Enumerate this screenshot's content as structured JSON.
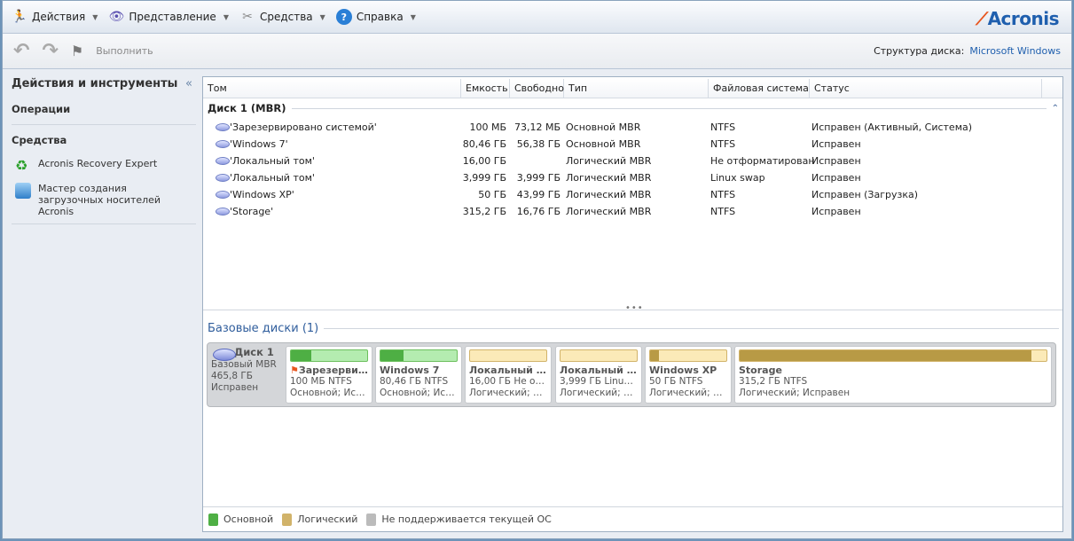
{
  "menu": [
    {
      "label": "Действия",
      "icon": "run-icon"
    },
    {
      "label": "Представление",
      "icon": "eye-icon"
    },
    {
      "label": "Средства",
      "icon": "tools-icon"
    },
    {
      "label": "Справка",
      "icon": "help-icon"
    }
  ],
  "logo": "Acronis",
  "toolbar": {
    "commit": "Выполнить"
  },
  "structure": {
    "label": "Структура диска:",
    "value": "Microsoft Windows"
  },
  "left": {
    "title": "Действия и инструменты",
    "operations": "Операции",
    "tools": "Средства",
    "items": [
      "Acronis Recovery Expert",
      "Мастер создания загрузочных носителей Acronis"
    ]
  },
  "columns": [
    "Том",
    "Емкость",
    "Свободно",
    "Тип",
    "Файловая система",
    "Статус"
  ],
  "group": "Диск 1 (MBR)",
  "rows": [
    [
      "'Зарезервировано системой'",
      "100 МБ",
      "73,12 МБ",
      "Основной MBR",
      "NTFS",
      "Исправен (Активный, Система)"
    ],
    [
      "'Windows 7'",
      "80,46 ГБ",
      "56,38 ГБ",
      "Основной MBR",
      "NTFS",
      "Исправен"
    ],
    [
      "'Локальный том'",
      "16,00 ГБ",
      "",
      "Логический MBR",
      "Не отформатирован",
      "Исправен"
    ],
    [
      "'Локальный том'",
      "3,999 ГБ",
      "3,999 ГБ",
      "Логический MBR",
      "Linux swap",
      "Исправен"
    ],
    [
      "'Windows XP'",
      "50 ГБ",
      "43,99 ГБ",
      "Логический MBR",
      "NTFS",
      "Исправен (Загрузка)"
    ],
    [
      "'Storage'",
      "315,2 ГБ",
      "16,76 ГБ",
      "Логический MBR",
      "NTFS",
      "Исправен"
    ]
  ],
  "basic_disks": "Базовые диски (1)",
  "disk": {
    "name": "Диск 1",
    "type": "Базовый MBR",
    "size": "465,8 ГБ",
    "status": "Исправен"
  },
  "partitions": [
    {
      "name": "Зарезервир...",
      "info": "100 МБ NTFS",
      "kind": "Основной; Исп...",
      "used": 0.27,
      "cls": "p"
    },
    {
      "name": "Windows 7",
      "info": "80,46 ГБ NTFS",
      "kind": "Основной; Исп...",
      "used": 0.3,
      "cls": "p"
    },
    {
      "name": "Локальный т...",
      "info": "16,00 ГБ Не от...",
      "kind": "Логический; И...",
      "used": 0,
      "cls": "l"
    },
    {
      "name": "Локальный т...",
      "info": "3,999 ГБ Linux ...",
      "kind": "Логический; И...",
      "used": 0,
      "cls": "l"
    },
    {
      "name": "Windows XP",
      "info": "50 ГБ NTFS",
      "kind": "Логический; И...",
      "used": 0.12,
      "cls": "l"
    },
    {
      "name": "Storage",
      "info": "315,2 ГБ NTFS",
      "kind": "Логический; Исправен",
      "used": 0.95,
      "cls": "l"
    }
  ],
  "legend": [
    "Основной",
    "Логический",
    "Не поддерживается текущей ОС"
  ]
}
